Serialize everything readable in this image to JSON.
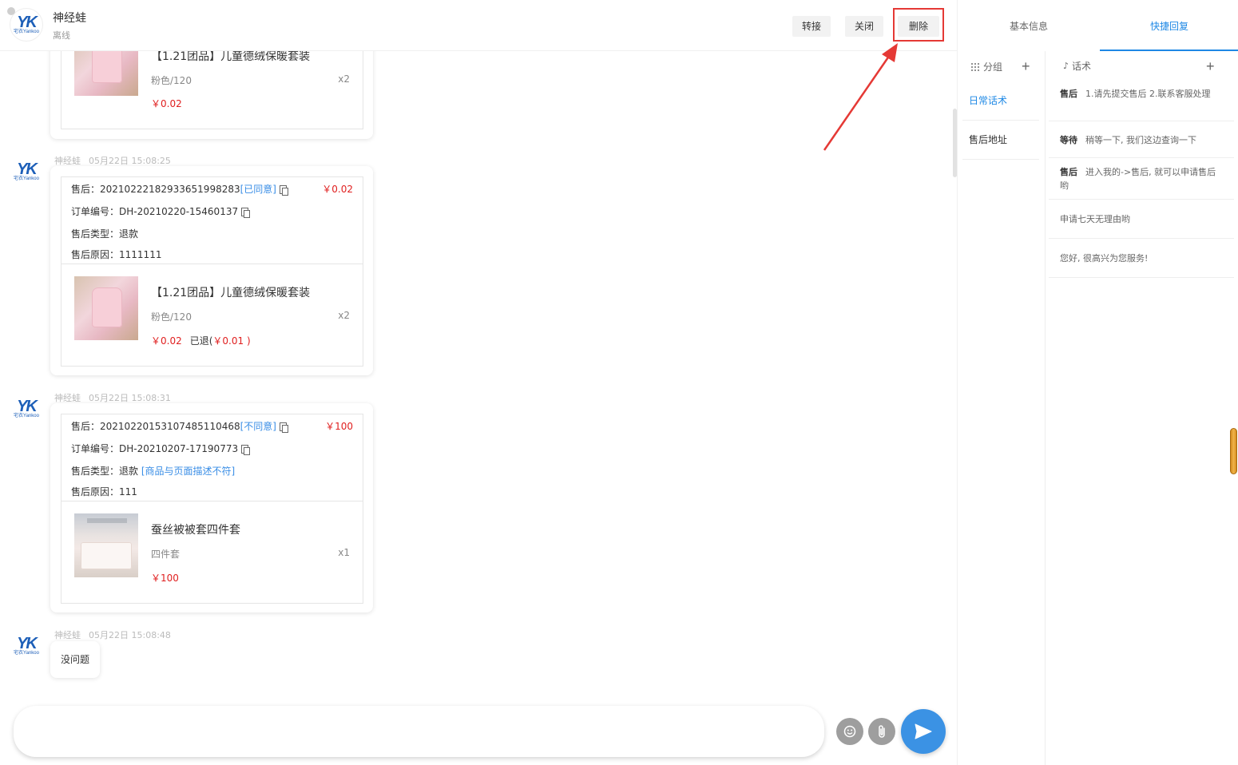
{
  "header": {
    "contact_name": "神经蛙",
    "status": "离线",
    "buttons": {
      "transfer": "转接",
      "close": "关闭",
      "delete": "删除"
    }
  },
  "logo": {
    "mark": "YK",
    "sub": "宅衣Yankoo"
  },
  "messages": [
    {
      "type": "product_partial",
      "product": {
        "name": "【1.21团品】儿童德绒保暖套装",
        "spec": "粉色/120",
        "qty": "x2",
        "price": "￥0.02"
      }
    },
    {
      "type": "after_sale",
      "sender": "神经蛙",
      "time": "05月22日 15:08:25",
      "after_sale_label": "售后：",
      "after_sale_no": "20210222182933651998283",
      "status": "[已同意]",
      "amount": "￥0.02",
      "order_label": "订单编号：",
      "order_no": "DH-20210220-15460137",
      "type_label": "售后类型：",
      "type_value": "退款",
      "reason_label": "售后原因：",
      "reason_value": "1111111",
      "product": {
        "name": "【1.21团品】儿童德绒保暖套装",
        "spec": "粉色/120",
        "qty": "x2",
        "price": "￥0.02",
        "refunded_label": "已退(",
        "refunded_amount": "￥0.01 )"
      }
    },
    {
      "type": "after_sale",
      "sender": "神经蛙",
      "time": "05月22日 15:08:31",
      "after_sale_label": "售后：",
      "after_sale_no": "20210220153107485110468",
      "status": "[不同意]",
      "amount": "￥100",
      "order_label": "订单编号：",
      "order_no": "DH-20210207-17190773",
      "type_label": "售后类型：",
      "type_value": "退款",
      "type_reason_tag": "[商品与页面描述不符]",
      "reason_label": "售后原因：",
      "reason_value": "111",
      "product": {
        "name": "蚕丝被被套四件套",
        "spec": "四件套",
        "qty": "x1",
        "price": "￥100"
      }
    },
    {
      "type": "text",
      "sender": "神经蛙",
      "time": "05月22日 15:08:48",
      "text": "没问题"
    }
  ],
  "input": {
    "placeholder": ""
  },
  "right_panel": {
    "tabs": [
      "基本信息",
      "快捷回复"
    ],
    "active_tab": "快捷回复",
    "groups_header": "分组",
    "replies_header": "话术",
    "groups": [
      {
        "label": "日常话术",
        "active": true
      },
      {
        "label": "售后地址",
        "active": false
      }
    ],
    "replies": [
      {
        "title": "售后",
        "text": "1.请先提交售后 2.联系客服处理"
      },
      {
        "title": "等待",
        "text": "稍等一下, 我们这边查询一下"
      },
      {
        "title": "售后",
        "text": "进入我的->售后, 就可以申请售后哟"
      },
      {
        "title": "",
        "text": "申请七天无理由哟"
      },
      {
        "title": "",
        "text": "您好, 很高兴为您服务!"
      }
    ]
  },
  "colors": {
    "accent": "#1e88e5",
    "price": "#e02020",
    "highlight": "#e53935",
    "send": "#3b92e4"
  },
  "icons": [
    "emoji-icon",
    "paperclip-icon",
    "send-icon",
    "grid-icon",
    "plus-icon",
    "copy-icon"
  ]
}
